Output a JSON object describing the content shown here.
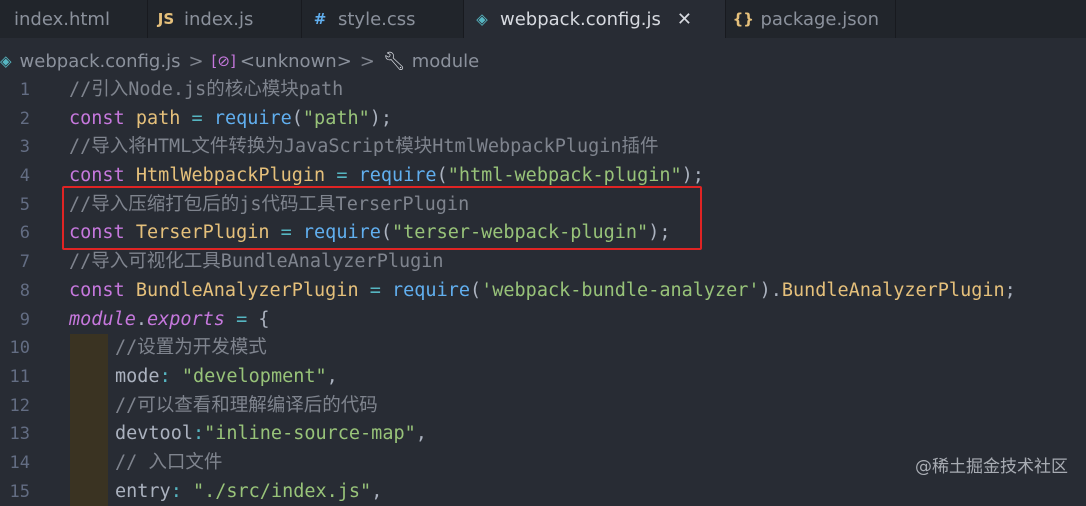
{
  "tabs": [
    {
      "label": "index.html",
      "icon": "html-file-icon",
      "glyph": "",
      "color": "#e06c75",
      "active": false
    },
    {
      "label": "index.js",
      "icon": "js-file-icon",
      "glyph": "JS",
      "color": "#e5c07b",
      "active": false
    },
    {
      "label": "style.css",
      "icon": "css-file-icon",
      "glyph": "#",
      "color": "#61afef",
      "active": false
    },
    {
      "label": "webpack.config.js",
      "icon": "webpack-file-icon",
      "glyph": "◈",
      "color": "#56b6c2",
      "active": true
    },
    {
      "label": "package.json",
      "icon": "json-file-icon",
      "glyph": "{}",
      "color": "#e5c07b",
      "active": false
    }
  ],
  "close_glyph": "✕",
  "breadcrumb": {
    "file": "webpack.config.js",
    "symbol": "<unknown>",
    "module": "module",
    "sep": ">"
  },
  "code_lines": [
    {
      "n": "1",
      "tokens": [
        [
          "c",
          "//引入Node.js的核心模块path"
        ]
      ]
    },
    {
      "n": "2",
      "tokens": [
        [
          "k",
          "const "
        ],
        [
          "v",
          "path"
        ],
        [
          "o",
          " = "
        ],
        [
          "f",
          "require"
        ],
        [
          "p",
          "("
        ],
        [
          "s",
          "\"path\""
        ],
        [
          "p",
          ");"
        ]
      ]
    },
    {
      "n": "3",
      "tokens": [
        [
          "c",
          "//导入将HTML文件转换为JavaScript模块HtmlWebpackPlugin插件"
        ]
      ]
    },
    {
      "n": "4",
      "tokens": [
        [
          "k",
          "const "
        ],
        [
          "v",
          "HtmlWebpackPlugin"
        ],
        [
          "o",
          " = "
        ],
        [
          "f",
          "require"
        ],
        [
          "p",
          "("
        ],
        [
          "s",
          "\"html-webpack-plugin\""
        ],
        [
          "p",
          ");"
        ]
      ]
    },
    {
      "n": "5",
      "tokens": [
        [
          "c",
          "//导入压缩打包后的js代码工具TerserPlugin"
        ]
      ]
    },
    {
      "n": "6",
      "tokens": [
        [
          "k",
          "const "
        ],
        [
          "v",
          "TerserPlugin"
        ],
        [
          "o",
          " = "
        ],
        [
          "f",
          "require"
        ],
        [
          "p",
          "("
        ],
        [
          "s",
          "\"terser-webpack-plugin\""
        ],
        [
          "p",
          ");"
        ]
      ]
    },
    {
      "n": "7",
      "tokens": [
        [
          "c",
          "//导入可视化工具BundleAnalyzerPlugin"
        ]
      ]
    },
    {
      "n": "8",
      "tokens": [
        [
          "k",
          "const "
        ],
        [
          "v",
          "BundleAnalyzerPlugin"
        ],
        [
          "o",
          " = "
        ],
        [
          "f",
          "require"
        ],
        [
          "p",
          "("
        ],
        [
          "s",
          "'webpack-bundle-analyzer'"
        ],
        [
          "p",
          ")."
        ],
        [
          "v",
          "BundleAnalyzerPlugin"
        ],
        [
          "p",
          ";"
        ]
      ]
    },
    {
      "n": "9",
      "tokens": [
        [
          "kit",
          "module"
        ],
        [
          "p",
          "."
        ],
        [
          "kit",
          "exports"
        ],
        [
          "o",
          " = "
        ],
        [
          "p",
          "{"
        ]
      ]
    },
    {
      "n": "10",
      "indent": true,
      "tokens": [
        [
          "c",
          "//设置为开发模式"
        ]
      ]
    },
    {
      "n": "11",
      "indent": true,
      "tokens": [
        [
          "p",
          "mode"
        ],
        [
          "o",
          ": "
        ],
        [
          "s",
          "\"development\""
        ],
        [
          "p",
          ","
        ]
      ]
    },
    {
      "n": "12",
      "indent": true,
      "tokens": [
        [
          "c",
          "//可以查看和理解编译后的代码"
        ]
      ]
    },
    {
      "n": "13",
      "indent": true,
      "tokens": [
        [
          "p",
          "devtool"
        ],
        [
          "o",
          ":"
        ],
        [
          "s",
          "\"inline-source-map\""
        ],
        [
          "p",
          ","
        ]
      ]
    },
    {
      "n": "14",
      "indent": true,
      "tokens": [
        [
          "c",
          "// 入口文件"
        ]
      ]
    },
    {
      "n": "15",
      "indent": true,
      "tokens": [
        [
          "p",
          "entry"
        ],
        [
          "o",
          ": "
        ],
        [
          "s",
          "\"./src/index.js\""
        ],
        [
          "p",
          ","
        ]
      ]
    }
  ],
  "watermark": "@稀土掘金技术社区",
  "colors": {
    "highlight_box": "#e02424",
    "background": "#282c34"
  }
}
